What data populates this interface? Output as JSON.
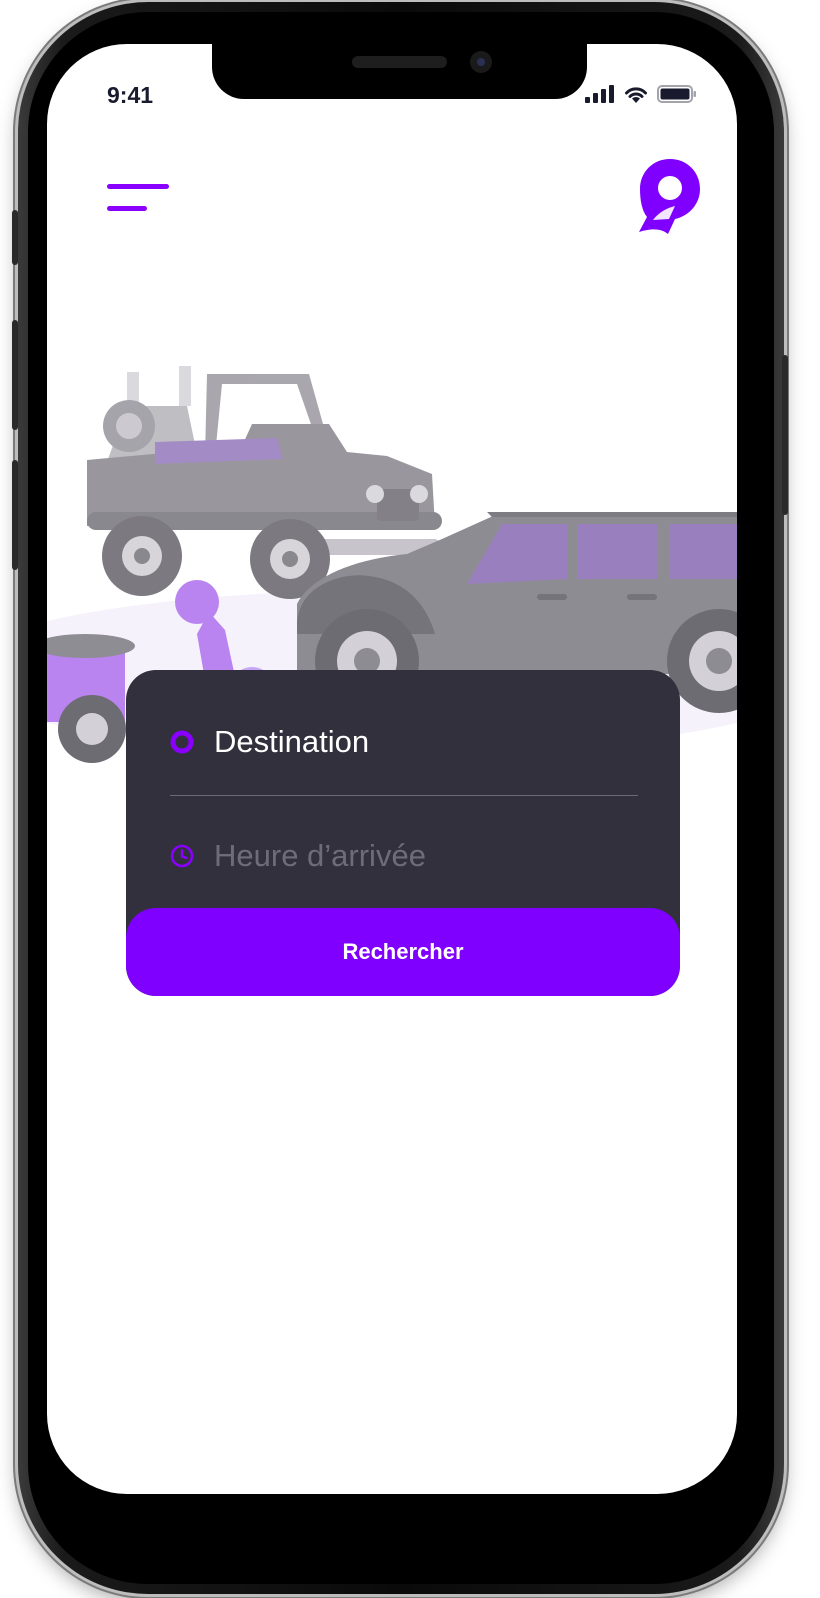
{
  "status_bar": {
    "time": "9:41"
  },
  "header": {
    "menu_icon": "hamburger-menu-icon",
    "logo_icon": "location-pin-logo"
  },
  "search": {
    "destination_placeholder": "Destination",
    "arrival_placeholder": "Heure d’arrivée",
    "button_label": "Rechercher"
  },
  "colors": {
    "accent": "#8000ff",
    "card_bg": "#32303c",
    "placeholder": "#6e6c78",
    "vehicle_gray": "#a8a6ad",
    "vehicle_purple": "#b983f0"
  }
}
